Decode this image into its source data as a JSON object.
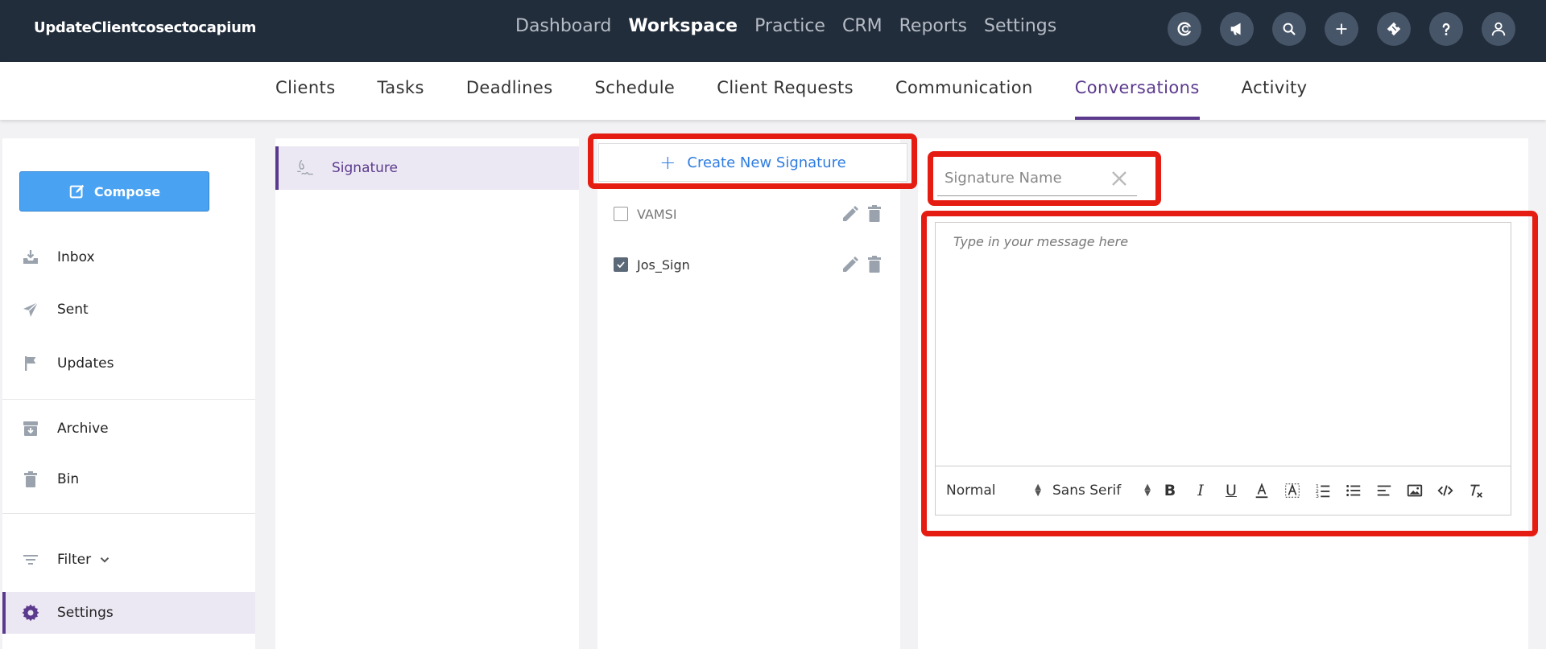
{
  "brand": "UpdateClientcosectocapium",
  "main_nav": [
    "Dashboard",
    "Workspace",
    "Practice",
    "CRM",
    "Reports",
    "Settings"
  ],
  "main_nav_active": "Workspace",
  "top_icons": [
    "logo-c-icon",
    "megaphone-icon",
    "search-icon",
    "plus-icon",
    "ticket-icon",
    "help-icon",
    "user-icon"
  ],
  "sub_nav": {
    "tabs": [
      "Clients",
      "Tasks",
      "Deadlines",
      "Schedule",
      "Client Requests",
      "Communication",
      "Conversations",
      "Activity"
    ],
    "active": "Conversations"
  },
  "sidebar": {
    "compose_label": "Compose",
    "items": [
      {
        "label": "Inbox",
        "icon": "inbox-icon"
      },
      {
        "label": "Sent",
        "icon": "send-icon"
      },
      {
        "label": "Updates",
        "icon": "flag-icon"
      },
      {
        "label": "Archive",
        "icon": "archive-icon"
      },
      {
        "label": "Bin",
        "icon": "trash-icon"
      },
      {
        "label": "Filter",
        "icon": "filter-icon"
      },
      {
        "label": "Settings",
        "icon": "gear-icon"
      }
    ]
  },
  "settings_menu": {
    "item_label": "Signature"
  },
  "signatures": {
    "create_label": "Create New Signature",
    "items": [
      {
        "name": "VAMSI",
        "checked": false
      },
      {
        "name": "Jos_Sign",
        "checked": true
      }
    ]
  },
  "editor": {
    "name_placeholder": "Signature Name",
    "message_placeholder": "Type in your message here",
    "format_select": "Normal",
    "font_select": "Sans Serif"
  },
  "colors": {
    "topbar": "#222d3b",
    "accent": "#5b3a8e",
    "compose": "#4aa3f2",
    "link": "#2f7de1",
    "highlight": "#e51c12"
  }
}
